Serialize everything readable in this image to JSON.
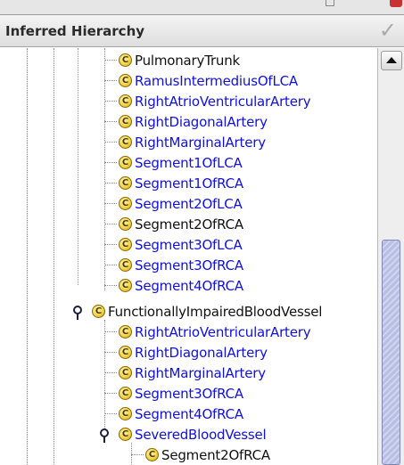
{
  "panel": {
    "title": "Inferred Hierarchy",
    "status_icon": "check-icon",
    "colors": {
      "asserted": "#111111",
      "inferred": "#1010e0",
      "scroll_thumb": "#b8bfe4"
    }
  },
  "tree": {
    "group1_children": [
      {
        "label": "PulmonaryTrunk",
        "style": "black",
        "icon": "class-icon"
      },
      {
        "label": "RamusIntermediusOfLCA",
        "style": "blue",
        "icon": "class-icon"
      },
      {
        "label": "RightAtrioVentricularArtery",
        "style": "blue",
        "icon": "class-icon"
      },
      {
        "label": "RightDiagonalArtery",
        "style": "blue",
        "icon": "class-icon"
      },
      {
        "label": "RightMarginalArtery",
        "style": "blue",
        "icon": "class-icon"
      },
      {
        "label": "Segment1OfLCA",
        "style": "blue",
        "icon": "class-icon"
      },
      {
        "label": "Segment1OfRCA",
        "style": "blue",
        "icon": "class-icon"
      },
      {
        "label": "Segment2OfLCA",
        "style": "blue",
        "icon": "class-icon"
      },
      {
        "label": "Segment2OfRCA",
        "style": "black",
        "icon": "class-icon"
      },
      {
        "label": "Segment3OfLCA",
        "style": "blue",
        "icon": "class-icon"
      },
      {
        "label": "Segment3OfRCA",
        "style": "blue",
        "icon": "class-icon"
      },
      {
        "label": "Segment4OfRCA",
        "style": "blue",
        "icon": "class-icon"
      }
    ],
    "parent": {
      "label": "FunctionallyImpairedBloodVessel",
      "style": "black",
      "icon": "class-icon",
      "expanded": true
    },
    "group2_children": [
      {
        "label": "RightAtrioVentricularArtery",
        "style": "blue",
        "icon": "class-icon"
      },
      {
        "label": "RightDiagonalArtery",
        "style": "blue",
        "icon": "class-icon"
      },
      {
        "label": "RightMarginalArtery",
        "style": "blue",
        "icon": "class-icon"
      },
      {
        "label": "Segment3OfRCA",
        "style": "blue",
        "icon": "class-icon"
      },
      {
        "label": "Segment4OfRCA",
        "style": "blue",
        "icon": "class-icon"
      },
      {
        "label": "SeveredBloodVessel",
        "style": "blue",
        "icon": "class-icon",
        "expanded": true
      }
    ],
    "group3_children": [
      {
        "label": "Segment2OfRCA",
        "style": "black",
        "icon": "class-icon"
      }
    ]
  }
}
